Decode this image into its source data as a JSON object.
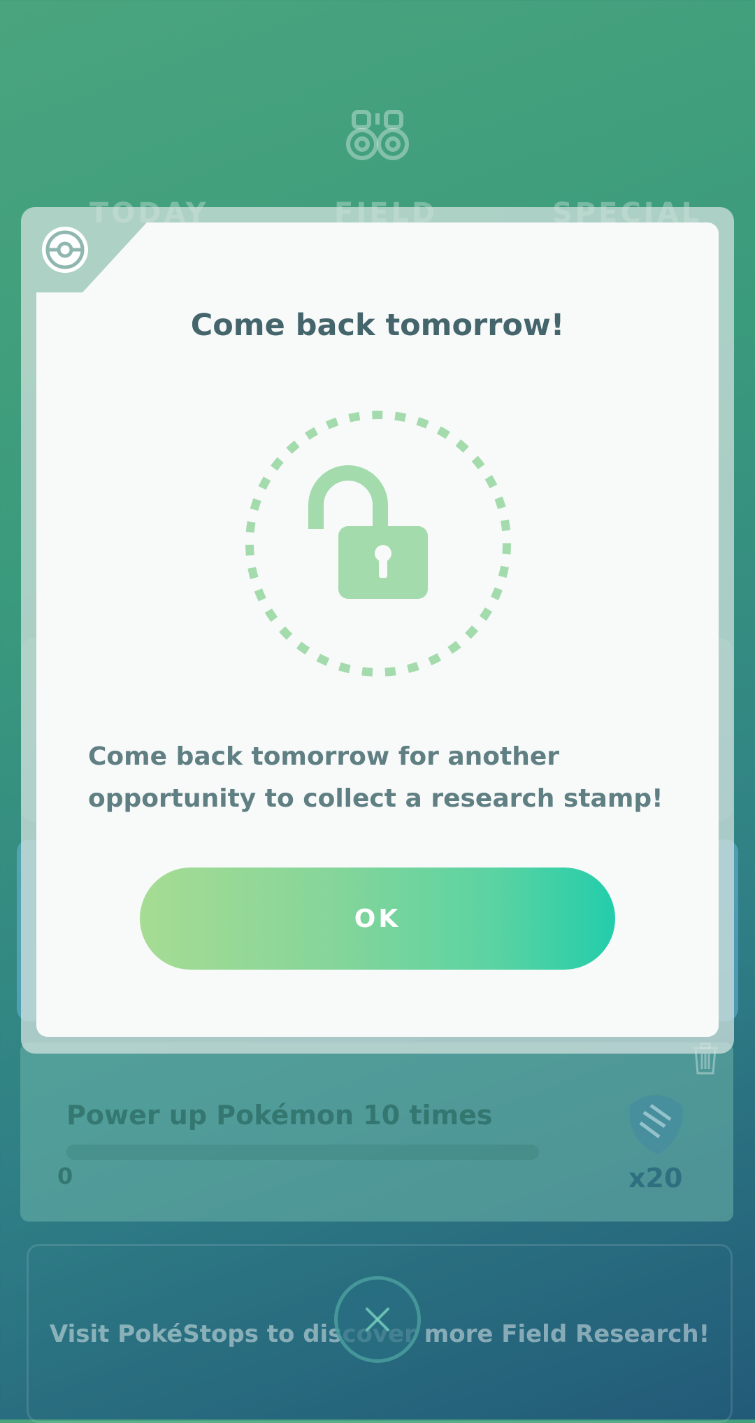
{
  "background": {
    "tabs": [
      "TODAY",
      "FIELD",
      "SPECIAL"
    ],
    "task": {
      "title": "Power up Pokémon 10 times",
      "progress": 0,
      "progress_label": "0",
      "reward_count": "x20",
      "reward_icon": "rare-candy-icon"
    },
    "visit_text": "Visit PokéStops to discover more Field Research!",
    "icons": [
      "binoculars-icon",
      "trash-icon",
      "close-icon"
    ]
  },
  "modal": {
    "icon": "pokeball-icon",
    "title": "Come back tomorrow!",
    "graphic_icon": "unlocked-padlock-icon",
    "message": "Come back tomorrow for another opportunity to collect a research stamp!",
    "ok_label": "OK"
  },
  "colors": {
    "title": "#44656b",
    "message": "#5f7f83",
    "lock_green": "#a3dbad",
    "button_start": "#a6dc93",
    "button_end": "#23cdab"
  }
}
